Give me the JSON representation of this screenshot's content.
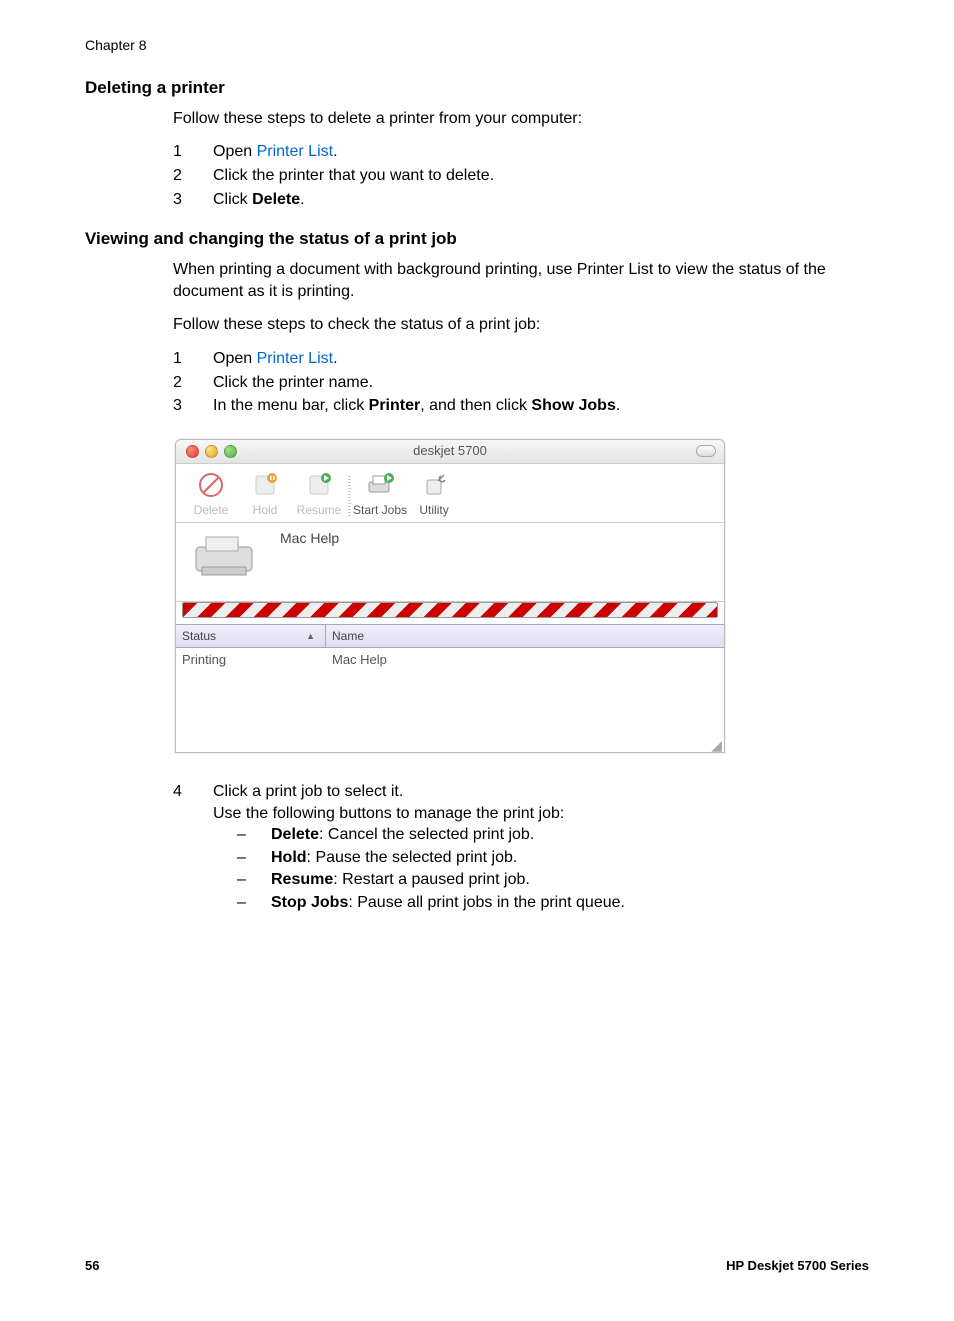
{
  "chapter": "Chapter 8",
  "sec1": {
    "title": "Deleting a printer",
    "intro": "Follow these steps to delete a printer from your computer:",
    "steps": [
      {
        "n": "1",
        "pre": "Open ",
        "link": "Printer List",
        "post": "."
      },
      {
        "n": "2",
        "text": "Click the printer that you want to delete."
      },
      {
        "n": "3",
        "pre": "Click ",
        "bold": "Delete",
        "post": "."
      }
    ]
  },
  "sec2": {
    "title": "Viewing and changing the status of a print job",
    "intro1": "When printing a document with background printing, use Printer List to view the status of the document as it is printing.",
    "intro2": "Follow these steps to check the status of a print job:",
    "steps_a": [
      {
        "n": "1",
        "pre": "Open ",
        "link": "Printer List",
        "post": "."
      },
      {
        "n": "2",
        "text": "Click the printer name."
      },
      {
        "n": "3",
        "pre": "In the menu bar, click ",
        "bold": "Printer",
        "mid": ", and then click ",
        "bold2": "Show Jobs",
        "post": "."
      }
    ],
    "step4": {
      "n": "4",
      "line1": "Click a print job to select it.",
      "line2": "Use the following buttons to manage the print job:",
      "bullets": [
        {
          "b": "Delete",
          "t": ": Cancel the selected print job."
        },
        {
          "b": "Hold",
          "t": ": Pause the selected print job."
        },
        {
          "b": "Resume",
          "t": ": Restart a paused print job."
        },
        {
          "b": "Stop Jobs",
          "t": ": Pause all print jobs in the print queue."
        }
      ]
    }
  },
  "window": {
    "title": "deskjet 5700",
    "toolbar": {
      "delete": "Delete",
      "hold": "Hold",
      "resume": "Resume",
      "start": "Start Jobs",
      "utility": "Utility"
    },
    "doc": "Mac Help",
    "col_status": "Status",
    "col_name": "Name",
    "row_status": "Printing",
    "row_name": "Mac Help"
  },
  "footer": {
    "page": "56",
    "product": "HP Deskjet 5700 Series"
  }
}
